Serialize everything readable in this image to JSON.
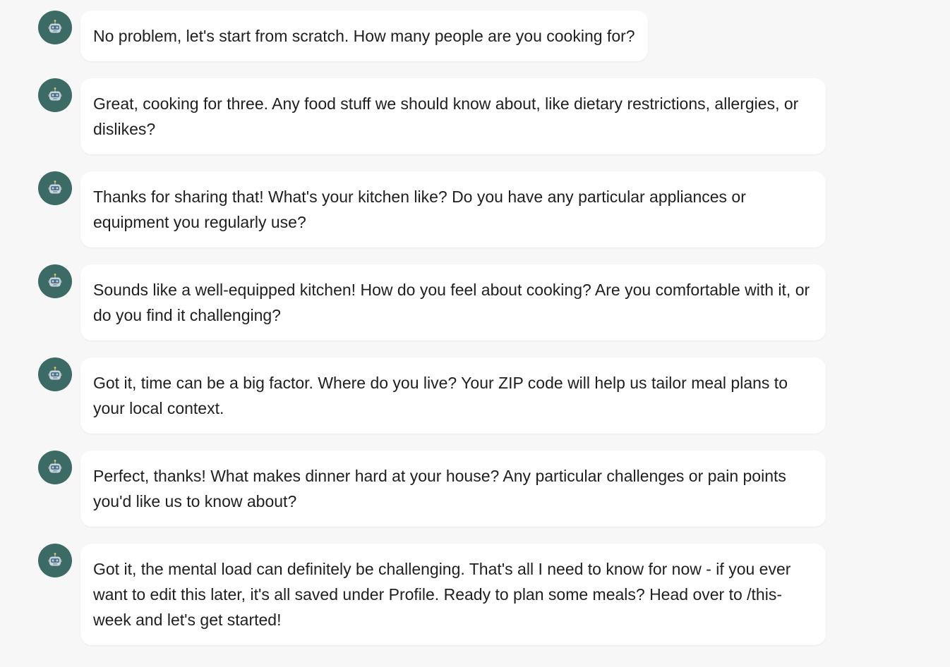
{
  "conversation": {
    "messages": [
      {
        "sender": "bot",
        "avatar_icon": "robot-icon",
        "text": "No problem, let's start from scratch. How many people are you cooking for?"
      },
      {
        "sender": "bot",
        "avatar_icon": "robot-icon",
        "text": "Great, cooking for three. Any food stuff we should know about, like dietary restrictions, allergies, or dislikes?"
      },
      {
        "sender": "bot",
        "avatar_icon": "robot-icon",
        "text": "Thanks for sharing that! What's your kitchen like? Do you have any particular appliances or equipment you regularly use?"
      },
      {
        "sender": "bot",
        "avatar_icon": "robot-icon",
        "text": "Sounds like a well-equipped kitchen! How do you feel about cooking? Are you comfortable with it, or do you find it challenging?"
      },
      {
        "sender": "bot",
        "avatar_icon": "robot-icon",
        "text": "Got it, time can be a big factor. Where do you live? Your ZIP code will help us tailor meal plans to your local context."
      },
      {
        "sender": "bot",
        "avatar_icon": "robot-icon",
        "text": "Perfect, thanks! What makes dinner hard at your house? Any particular challenges or pain points you'd like us to know about?"
      },
      {
        "sender": "bot",
        "avatar_icon": "robot-icon",
        "text": "Got it, the mental load can definitely be challenging. That's all I need to know for now - if you ever want to edit this later, it's all saved under Profile. Ready to plan some meals? Head over to /this-week and let's get started!"
      }
    ]
  },
  "colors": {
    "background": "#f7f7f7",
    "bubble": "#ffffff",
    "avatar": "#3c6b66",
    "text": "#1f1f1f"
  }
}
